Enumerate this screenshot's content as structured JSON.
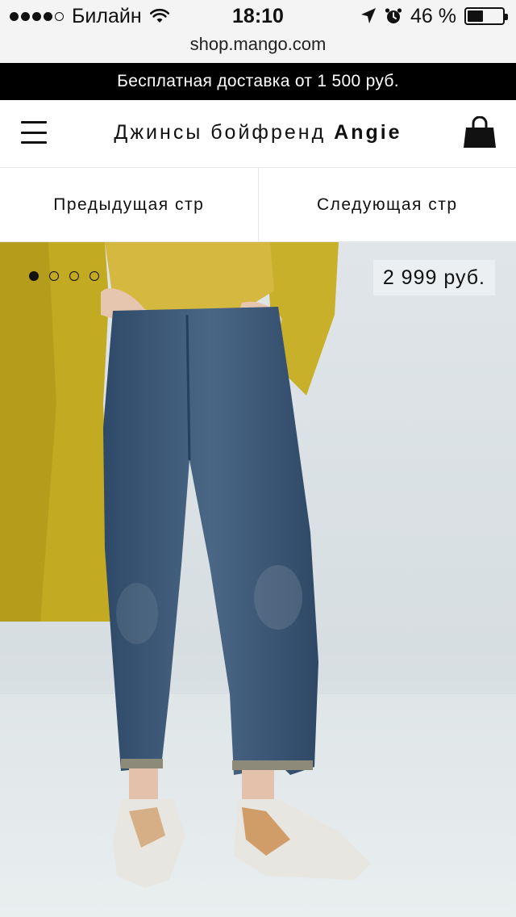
{
  "status_bar": {
    "signal_dots": [
      true,
      true,
      true,
      true,
      false
    ],
    "carrier": "Билайн",
    "time": "18:10",
    "battery_percent": "46 %",
    "battery_level": 0.46
  },
  "browser": {
    "url": "shop.mango.com"
  },
  "promo": {
    "text": "Бесплатная доставка от 1 500 руб."
  },
  "header": {
    "title_prefix": "Джинсы бойфренд ",
    "title_name": "Angie",
    "menu_icon": "hamburger-menu-icon",
    "bag_icon": "shopping-bag-icon"
  },
  "pager": {
    "prev_label": "Предыдущая стр",
    "next_label": "Следующая стр"
  },
  "product": {
    "price": "2 999 руб.",
    "carousel": {
      "total": 4,
      "active": 0
    },
    "colors": {
      "coat": "#c9b12a",
      "sweater": "#d3b63a",
      "denim": "#3d5a7c",
      "background": "#dce3e6"
    }
  }
}
